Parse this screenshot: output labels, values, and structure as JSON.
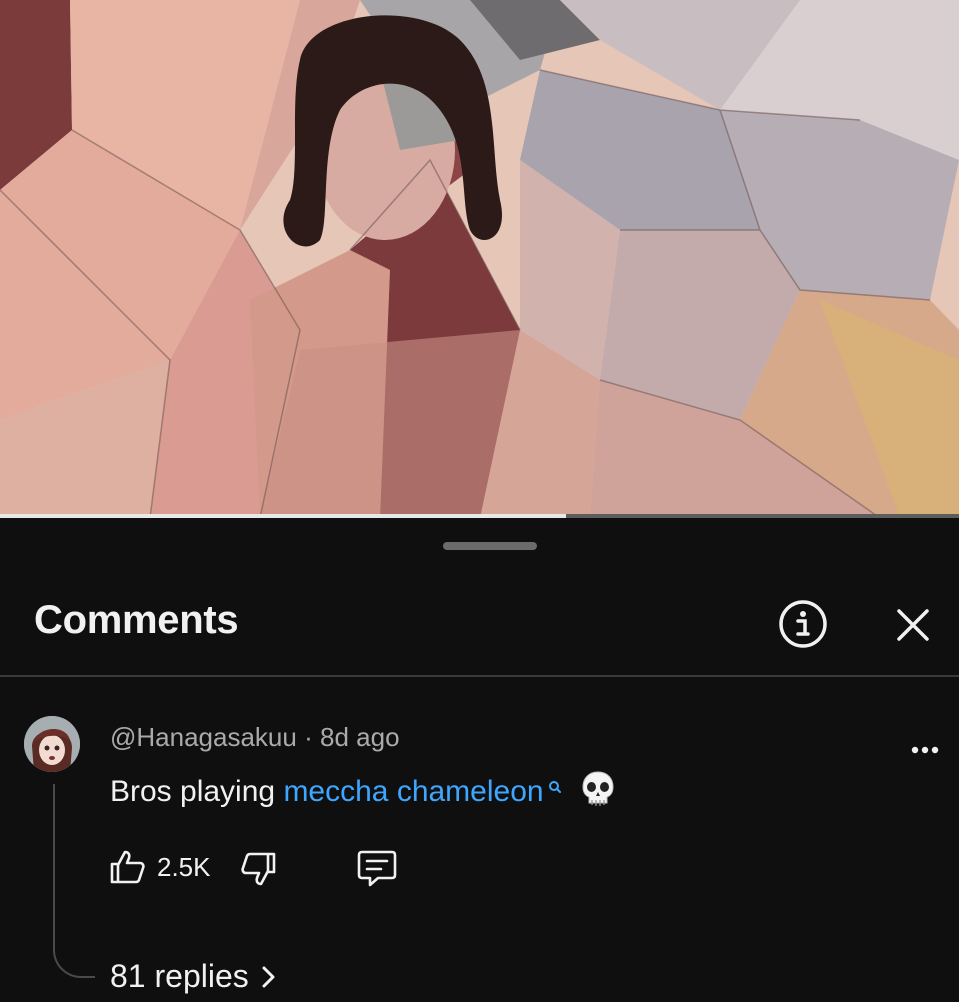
{
  "video": {
    "description_icon": "cubist-painted-figure-thumbnail",
    "progress_fraction": 0.59
  },
  "sheet": {
    "title": "Comments",
    "info_icon": "info-circle-icon",
    "close_icon": "close-icon"
  },
  "comment": {
    "author": "@Hanagasakuu",
    "separator": "·",
    "time": "8d ago",
    "text_prefix": "Bros playing ",
    "text_link": "meccha chameleon",
    "emoji": "skull",
    "likes": "2.5K",
    "replies_label": "81 replies"
  },
  "colors": {
    "background": "#0f0f0f",
    "link": "#3ea6ff",
    "meta": "#aaaaaa"
  }
}
